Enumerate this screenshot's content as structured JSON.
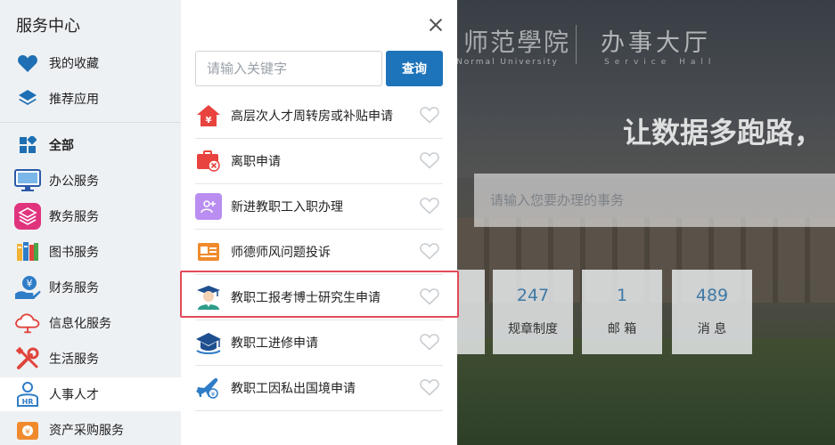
{
  "background": {
    "logo_text": "师范學院",
    "logo_sub": "Normal University",
    "hall_title": "办事大厅",
    "hall_sub": "Service Hall",
    "slogan": "让数据多跑路，",
    "search_placeholder": "请输入您要办理的事务",
    "stats": [
      {
        "value": "247",
        "label": "规章制度"
      },
      {
        "value": "1",
        "label": "邮 箱"
      },
      {
        "value": "489",
        "label": "消 息"
      }
    ]
  },
  "sidebar": {
    "title": "服务中心",
    "items": [
      {
        "label": "我的收藏",
        "icon": "heart-icon"
      },
      {
        "label": "推荐应用",
        "icon": "layers-icon"
      },
      {
        "label": "全部",
        "icon": "grid-icon"
      },
      {
        "label": "办公服务",
        "icon": "monitor-icon"
      },
      {
        "label": "教务服务",
        "icon": "stack-icon"
      },
      {
        "label": "图书服务",
        "icon": "books-icon"
      },
      {
        "label": "财务服务",
        "icon": "money-hand-icon"
      },
      {
        "label": "信息化服务",
        "icon": "cloud-icon"
      },
      {
        "label": "生活服务",
        "icon": "tools-icon"
      },
      {
        "label": "人事人才",
        "icon": "hr-icon"
      },
      {
        "label": "资产采购服务",
        "icon": "purchase-icon"
      }
    ]
  },
  "panel": {
    "search_placeholder": "请输入关键字",
    "search_button": "查询",
    "services": [
      {
        "label": "高层次人才周转房或补贴申请",
        "icon": "house-icon"
      },
      {
        "label": "离职申请",
        "icon": "resign-icon"
      },
      {
        "label": "新进教职工入职办理",
        "icon": "add-user-icon"
      },
      {
        "label": "师德师风问题投诉",
        "icon": "id-card-icon"
      },
      {
        "label": "教职工报考博士研究生申请",
        "icon": "graduate-icon"
      },
      {
        "label": "教职工进修申请",
        "icon": "grad-cap-icon"
      },
      {
        "label": "教职工因私出国境申请",
        "icon": "plane-icon"
      }
    ]
  },
  "colors": {
    "accent": "#1e74bb",
    "highlight": "#e24a5a",
    "stat_number": "#3e7aa5"
  }
}
